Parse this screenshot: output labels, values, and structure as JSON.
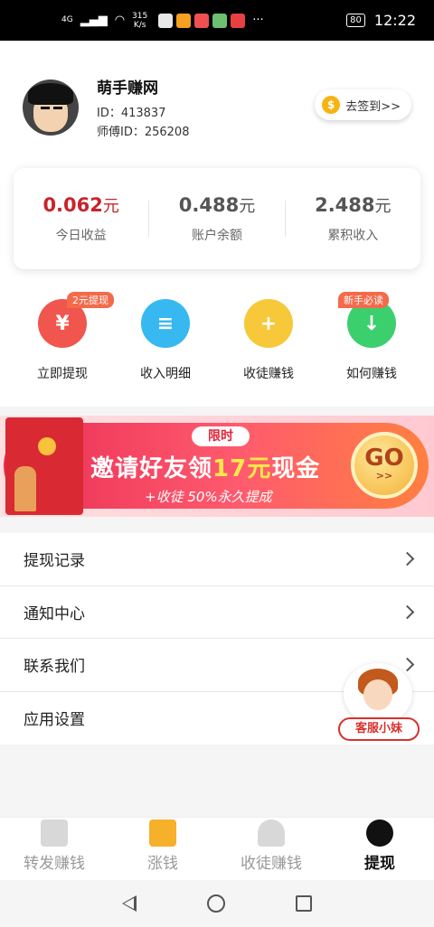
{
  "status_bar": {
    "network": "4G",
    "speed": "315",
    "speed_unit": "K/s",
    "battery": "80",
    "time": "12:22",
    "app_colors": [
      "#e8e8e8",
      "#f4a020",
      "#f05050",
      "#6cc070",
      "#e84040"
    ]
  },
  "profile": {
    "nickname": "萌手赚网",
    "id_text": "ID：413837",
    "master_id_text": "师傅ID：256208",
    "checkin_label": "去签到>>",
    "coin_glyph": "$"
  },
  "stats": [
    {
      "value": "0.062",
      "unit": "元",
      "label": "今日收益"
    },
    {
      "value": "0.488",
      "unit": "元",
      "label": "账户余额"
    },
    {
      "value": "2.488",
      "unit": "元",
      "label": "累积收入"
    }
  ],
  "actions": [
    {
      "label": "立即提现",
      "tag": "2元提现",
      "icon": "yuan-icon",
      "glyph": "¥",
      "color": "#f0564e"
    },
    {
      "label": "收入明细",
      "tag": "",
      "icon": "document-icon",
      "glyph": "≡",
      "color": "#37b8f0"
    },
    {
      "label": "收徒赚钱",
      "tag": "",
      "icon": "add-user-icon",
      "glyph": "+",
      "color": "#f7c83a"
    },
    {
      "label": "如何赚钱",
      "tag": "新手必读",
      "icon": "download-icon",
      "glyph": "↓",
      "color": "#3ccf6e"
    }
  ],
  "banner": {
    "limit_label": "限时",
    "title_prefix": "邀请好友领",
    "title_amount": "17元",
    "title_suffix": "现金",
    "subtitle": "+收徒 50%永久提成",
    "go_label": "GO",
    "go_arrow": ">>"
  },
  "menu": [
    {
      "label": "提现记录"
    },
    {
      "label": "通知中心"
    },
    {
      "label": "联系我们"
    },
    {
      "label": "应用设置"
    }
  ],
  "customer_service": {
    "label": "客服小妹"
  },
  "tabs": [
    {
      "label": "转发赚钱",
      "icon": "news-icon",
      "active": false
    },
    {
      "label": "涨钱",
      "icon": "money-jar-icon",
      "active": false
    },
    {
      "label": "收徒赚钱",
      "icon": "users-icon",
      "active": false
    },
    {
      "label": "提现",
      "icon": "wallet-face-icon",
      "active": true
    }
  ]
}
